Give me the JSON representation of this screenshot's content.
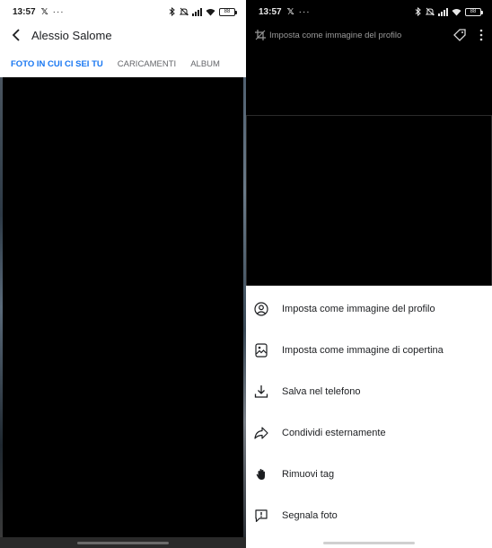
{
  "left": {
    "status": {
      "time": "13:57",
      "x_logo": "𝕏",
      "dots": "···",
      "battery": "88"
    },
    "header": {
      "title": "Alessio Salome"
    },
    "tabs": [
      {
        "label": "FOTO IN CUI CI SEI TU",
        "active": true
      },
      {
        "label": "CARICAMENTI",
        "active": false
      },
      {
        "label": "ALBUM",
        "active": false
      }
    ]
  },
  "right": {
    "status": {
      "time": "13:57",
      "x_logo": "𝕏",
      "dots": "···",
      "battery": "88"
    },
    "toolbar": {
      "label": "Imposta come immagine del profilo"
    },
    "menu": [
      {
        "label": "Imposta come immagine del profilo",
        "icon": "profile-circle-icon"
      },
      {
        "label": "Imposta come immagine di copertina",
        "icon": "cover-image-icon"
      },
      {
        "label": "Salva nel telefono",
        "icon": "download-icon"
      },
      {
        "label": "Condividi esternamente",
        "icon": "share-icon"
      },
      {
        "label": "Rimuovi tag",
        "icon": "hand-icon"
      },
      {
        "label": "Segnala foto",
        "icon": "report-icon"
      }
    ]
  },
  "colors": {
    "accent": "#1877f2",
    "text": "#1c1e21",
    "muted": "#65676b"
  }
}
